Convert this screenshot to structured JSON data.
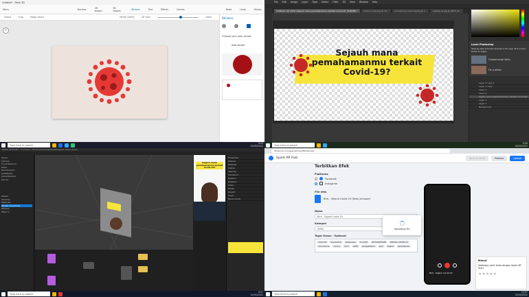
{
  "taskbar": {
    "search_placeholder": "Type here to search"
  },
  "q1": {
    "title": "Untitled* - Paint 3D",
    "menu": "Menu",
    "tools": [
      "Brushes",
      "2D shapes",
      "3D shapes",
      "Stickers",
      "Text",
      "Effects",
      "Canvas"
    ],
    "right_tools": [
      "Paste",
      "Undo",
      "History",
      "Redo"
    ],
    "select": "Select",
    "crop": "Crop",
    "magic_select": "Magic select",
    "zoom": "100%",
    "view3d": "3D view",
    "mixed_reality": "Mixed reality",
    "stickers_title": "Stickers",
    "choose": "Choose your own sticker",
    "add_sticker": "Add sticker",
    "clock": [
      "9:54",
      "02/05/2022"
    ]
  },
  "q2": {
    "menus": [
      "File",
      "Edit",
      "Image",
      "Layer",
      "Type",
      "Select",
      "Filter",
      "3D",
      "View",
      "Window",
      "Help"
    ],
    "tab_active": "Untitled-1 @ 100% (Sejauh mana pemahamanmu terkait Covid-19?, RGB/8#) *",
    "tabs": [
      "corona virus.png @ 10...",
      "coronavirus covid-19.png @ 1...",
      "casting up.jpg @ 100% (R..."
    ],
    "headline": [
      "Sejauh mana",
      "pemahamanmu terkait",
      "Covid-19?"
    ],
    "learn_title": "Learn Photoshop",
    "learn_desc": "Step-by-step tutorials directly in the app. Pick a topic below to begin:",
    "tutorials": [
      "Fundamental Skills",
      "Fix a photo"
    ],
    "layers": [
      "Layer 3 copy 2",
      "Layer 3 copy",
      "Layer 3",
      "Layer 2",
      "Sejauh mana pemahamanmu terkait Covid-19?",
      "Layer 1",
      "Layer 1",
      "Background"
    ],
    "clock": [
      "9:56",
      "02/05/2022"
    ]
  },
  "q3": {
    "title": "Spark AR Studio - C:\\Users\\...\\Documents\\Instastudio\\Sejauh mana.arproj",
    "sim_text": [
      "Sejauh mana",
      "pemahamanmu terkait",
      "Covid-19?"
    ],
    "scene": [
      "Scene",
      "Camera",
      "Focal Distance",
      "Plane",
      "faceTracker0",
      "faceMesh0",
      "planeTracker0",
      "Device",
      "Assets",
      "Textures",
      "Materials",
      "Patches",
      "Effect 1"
    ],
    "selected": "Sticker (Covid-19)",
    "inspector": [
      "Properties",
      "Texture",
      "Material",
      "Visible",
      "Opacity",
      "Transform",
      "Position",
      "Rotation",
      "Scale",
      "Width",
      "Height",
      "Layer",
      "Blend mode"
    ],
    "clock": [
      "9:57",
      "02/05/2022"
    ]
  },
  "q4": {
    "url": "facebook.com/sparkarhub/effects/new/",
    "logo": "Spark AR Hub",
    "btn_draft": "Save as Draft",
    "btn_prev": "Preview",
    "btn_submit": "Upload",
    "heading": "Terbitkan Efek",
    "platform_label": "Platforms",
    "platforms": [
      "Facebook",
      "Instagram"
    ],
    "file_label": "File efek",
    "file_name": "Bird - Sejauh Covid-19 (New).arexport",
    "name_label": "Nama",
    "name_value": "Bird - Sejauh Covid-19",
    "cat_label": "Kategori",
    "cat_value": "Selfie",
    "tags_label": "Tagar Kasus - Optional",
    "tags": [
      "Covid-19",
      "quarantine",
      "awareness",
      "Covid19",
      "#STAYATHOME",
      "#ROYAL COVID-19",
      "coronavirus",
      "corona",
      "virus",
      "selfie",
      "pengetahuan",
      "quiz",
      "sejauh",
      "pemahaman",
      "covid",
      "masker"
    ],
    "uploading": "Uploading file",
    "phone_name": "Bird - Sejauh Covid-19",
    "panel_title": "Bitmoji",
    "panel_q": "Seberapa yakin Anda dengan Spark AR Hub?",
    "clock": [
      "10:57",
      "02/05/2022"
    ]
  }
}
